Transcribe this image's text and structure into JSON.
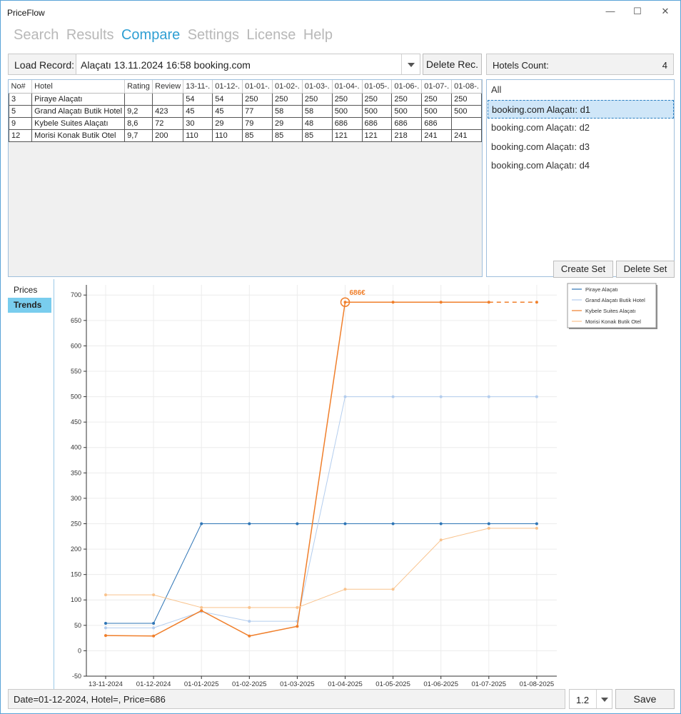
{
  "window": {
    "title": "PriceFlow",
    "minimize": "—",
    "maximize": "☐",
    "close": "✕"
  },
  "menu": [
    "Search",
    "Results",
    "Compare",
    "Settings",
    "License",
    "Help"
  ],
  "load": {
    "label": "Load Record:",
    "value": "Alaçatı 13.11.2024 16:58 booking.com",
    "delete_label": "Delete Rec."
  },
  "hotels_count": {
    "label": "Hotels Count:",
    "value": "4"
  },
  "table": {
    "columns": [
      "No#",
      "Hotel",
      "Rating",
      "Review",
      "13-11-.",
      "01-12-.",
      "01-01-.",
      "01-02-.",
      "01-03-.",
      "01-04-.",
      "01-05-.",
      "01-06-.",
      "01-07-.",
      "01-08-."
    ],
    "rows": [
      [
        "3",
        "Piraye Alaçatı",
        "",
        "",
        "54",
        "54",
        "250",
        "250",
        "250",
        "250",
        "250",
        "250",
        "250",
        "250"
      ],
      [
        "5",
        "Grand Alaçatı Butik Hotel",
        "9,2",
        "423",
        "45",
        "45",
        "77",
        "58",
        "58",
        "500",
        "500",
        "500",
        "500",
        "500"
      ],
      [
        "9",
        "Kybele Suites Alaçatı",
        "8,6",
        "72",
        "30",
        "29",
        "79",
        "29",
        "48",
        "686",
        "686",
        "686",
        "686",
        ""
      ],
      [
        "12",
        "Morisi Konak Butik Otel",
        "9,7",
        "200",
        "110",
        "110",
        "85",
        "85",
        "85",
        "121",
        "121",
        "218",
        "241",
        "241"
      ]
    ]
  },
  "sets": {
    "items": [
      "All",
      "booking.com Alaçatı: d1",
      "booking.com Alaçatı: d2",
      "booking.com Alaçatı: d3",
      "booking.com Alaçatı: d4"
    ],
    "selected_index": 1,
    "create_label": "Create Set",
    "delete_label": "Delete Set"
  },
  "tabs": [
    "Prices",
    "Trends"
  ],
  "active_tab": 1,
  "status": "Date=01-12-2024, Hotel=, Price=686",
  "zoom": "1.2",
  "save_label": "Save",
  "chart_data": {
    "type": "line",
    "categories": [
      "13-11-2024",
      "01-12-2024",
      "01-01-2025",
      "01-02-2025",
      "01-03-2025",
      "01-04-2025",
      "01-05-2025",
      "01-06-2025",
      "01-07-2025",
      "01-08-2025"
    ],
    "ylim": [
      -50,
      720
    ],
    "yticks": [
      -50,
      0,
      50,
      100,
      150,
      200,
      250,
      300,
      350,
      400,
      450,
      500,
      550,
      600,
      650,
      700
    ],
    "grid": true,
    "legend_position": "top-right",
    "series": [
      {
        "name": "Piraye Alaçatı",
        "color": "#2e75b6",
        "width": 1,
        "values": [
          54,
          54,
          250,
          250,
          250,
          250,
          250,
          250,
          250,
          250
        ]
      },
      {
        "name": "Grand Alaçatı Butik Hotel",
        "color": "#b3cdee",
        "width": 1,
        "values": [
          45,
          45,
          77,
          58,
          58,
          500,
          500,
          500,
          500,
          500
        ]
      },
      {
        "name": "Kybele Suites Alaçatı",
        "color": "#f07f2b",
        "width": 1.5,
        "values": [
          30,
          29,
          79,
          29,
          48,
          686,
          686,
          686,
          686,
          null
        ],
        "dashed_tail_to": 686
      },
      {
        "name": "Morisi Konak Butik Otel",
        "color": "#f9c38d",
        "width": 1,
        "values": [
          110,
          110,
          85,
          85,
          85,
          121,
          121,
          218,
          241,
          241
        ]
      }
    ],
    "highlight": {
      "series": 2,
      "index": 5,
      "label": "686€"
    }
  }
}
